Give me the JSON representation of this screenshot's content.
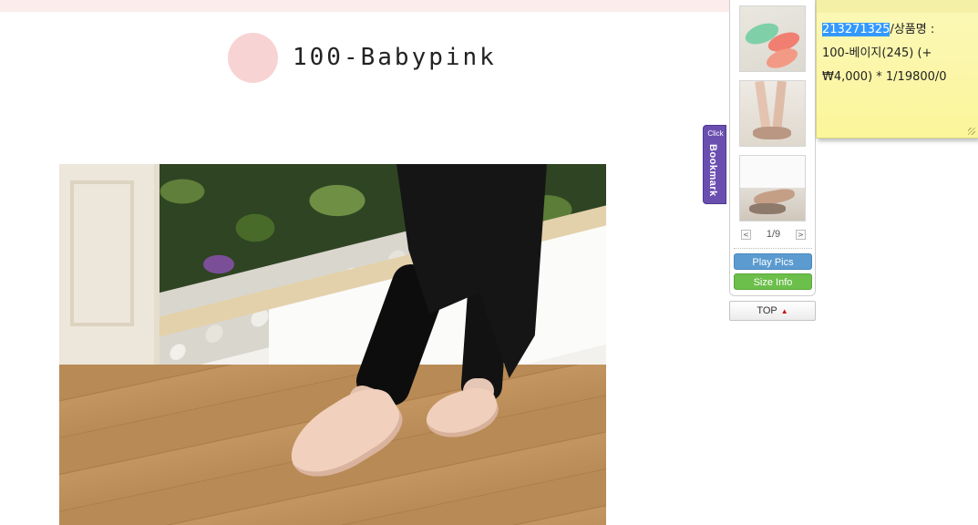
{
  "product": {
    "color_name": "100-Babypink",
    "color_dot": "#f8d3d4"
  },
  "photo": {
    "subject": "model wearing pink oxford flat shoes"
  },
  "bookmark": {
    "click_label": "Click",
    "label": "Bookmark"
  },
  "quick_panel": {
    "thumbnails": [
      {
        "name": "thumbnail-green-coral-flats"
      },
      {
        "name": "thumbnail-strappy-sandals"
      },
      {
        "name": "thumbnail-seated-sandals"
      }
    ],
    "pager": {
      "count": "1/9",
      "prev": "<",
      "next": ">"
    },
    "play_pics_label": "Play Pics",
    "size_info_label": "Size Info",
    "top_label": "TOP",
    "top_arrow": "▲"
  },
  "sticky_note": {
    "code": "213271325",
    "text_line1": "/상품명 :",
    "text_line2": "100-베이지(245) (+",
    "text_line3": "₩4,000) * 1/19800/0"
  },
  "colors": {
    "accent_bookmark": "#6a4fb0",
    "play_button": "#5b9bd0",
    "size_button": "#6cbf4a",
    "sticky_bg": "#fbf8b8",
    "selection": "#3399ff"
  }
}
